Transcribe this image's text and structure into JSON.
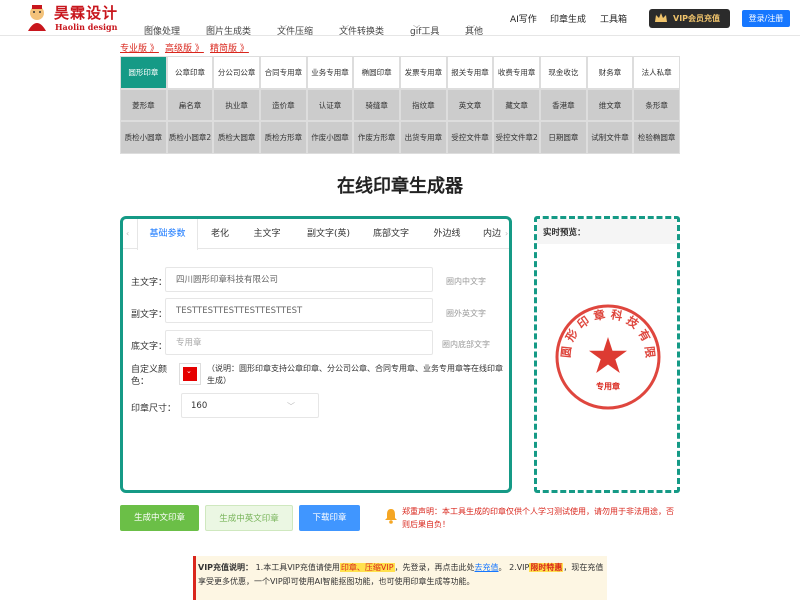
{
  "header": {
    "logo_title": "昊霖设计",
    "logo_sub": "Haolin design",
    "nav": [
      {
        "label": "图像处理",
        "has_dropdown": true
      },
      {
        "label": "图片生成类",
        "has_dropdown": true
      },
      {
        "label": "文件压缩",
        "has_dropdown": true
      },
      {
        "label": "文件转换类",
        "has_dropdown": true
      },
      {
        "label": "gif工具",
        "has_dropdown": true
      },
      {
        "label": "其他",
        "has_dropdown": true
      },
      {
        "label": "AI写作",
        "has_dropdown": false
      },
      {
        "label": "印章生成",
        "has_dropdown": false
      },
      {
        "label": "工具箱",
        "has_dropdown": false
      }
    ],
    "vip_button": "VIP会员充值",
    "login_button": "登录/注册"
  },
  "versions": [
    "专业版 》",
    "高级版 》",
    "精简版 》"
  ],
  "seal_types": {
    "row1": [
      "圆形印章",
      "公章印章",
      "分公司公章",
      "合同专用章",
      "业务专用章",
      "椭圆印章",
      "发票专用章",
      "报关专用章",
      "收费专用章",
      "现金收讫",
      "财务章",
      "法人私章"
    ],
    "row2": [
      "菱形章",
      "扁名章",
      "执业章",
      "造价章",
      "认证章",
      "骑缝章",
      "指纹章",
      "英文章",
      "藏文章",
      "香港章",
      "维文章",
      "条形章"
    ],
    "row3": [
      "质检小圆章",
      "质检小圆章2",
      "质检大圆章",
      "质检方形章",
      "作废小圆章",
      "作废方形章",
      "出货专用章",
      "受控文件章",
      "受控文件章2",
      "日期圆章",
      "试制文件章",
      "检验椭圆章"
    ],
    "active": "圆形印章"
  },
  "page_title": "在线印章生成器",
  "form": {
    "tabs": [
      "基础参数",
      "老化",
      "主文字",
      "副文字(英)",
      "底部文字",
      "外边线",
      "内边"
    ],
    "active_tab": "基础参数",
    "main_text_label": "主文字：",
    "main_text_value": "四川圆形印章科技有限公司",
    "main_text_hint": "圈内中文字",
    "sub_text_label": "副文字：",
    "sub_text_value": "TESTTESTTESTTESTTESTTEST",
    "sub_text_hint": "圈外英文字",
    "bottom_text_label": "底文字：",
    "bottom_text_placeholder": "专用章",
    "bottom_text_hint": "圈内底部文字",
    "color_label": "自定义颜色：",
    "color_value": "#e50000",
    "color_note": "（说明：圆形印章支持公章印章、分公司公章、合同专用章、业务专用章等在线印章生成）",
    "size_label": "印章尺寸：",
    "size_value": "160"
  },
  "preview": {
    "label": "实时预览：",
    "seal_main_text": "四川圆形印章科技有限公司",
    "seal_bottom_text": "专用章",
    "seal_color": "#d9261c"
  },
  "buttons": {
    "gen_cn": "生成中文印章",
    "gen_cn_en": "生成中英文印章",
    "download": "下载印章"
  },
  "disclaimer": "郑重声明：本工具生成的印章仅供个人学习测试使用，请勿用于非法用途，否则后果自负！",
  "vip_notice": {
    "label": "VIP充值说明：",
    "part1": "1.本工具VIP充值请使用",
    "hl1": "印章、压缩VIP",
    "part2": "，先登录，再点击此处",
    "link": "去充值",
    "part3": "。 2.VIP",
    "hl2": "限时特惠",
    "part4": "，现在充值享受更多优惠，一个VIP即可使用AI智能抠图功能，也可使用印章生成等功能。"
  }
}
